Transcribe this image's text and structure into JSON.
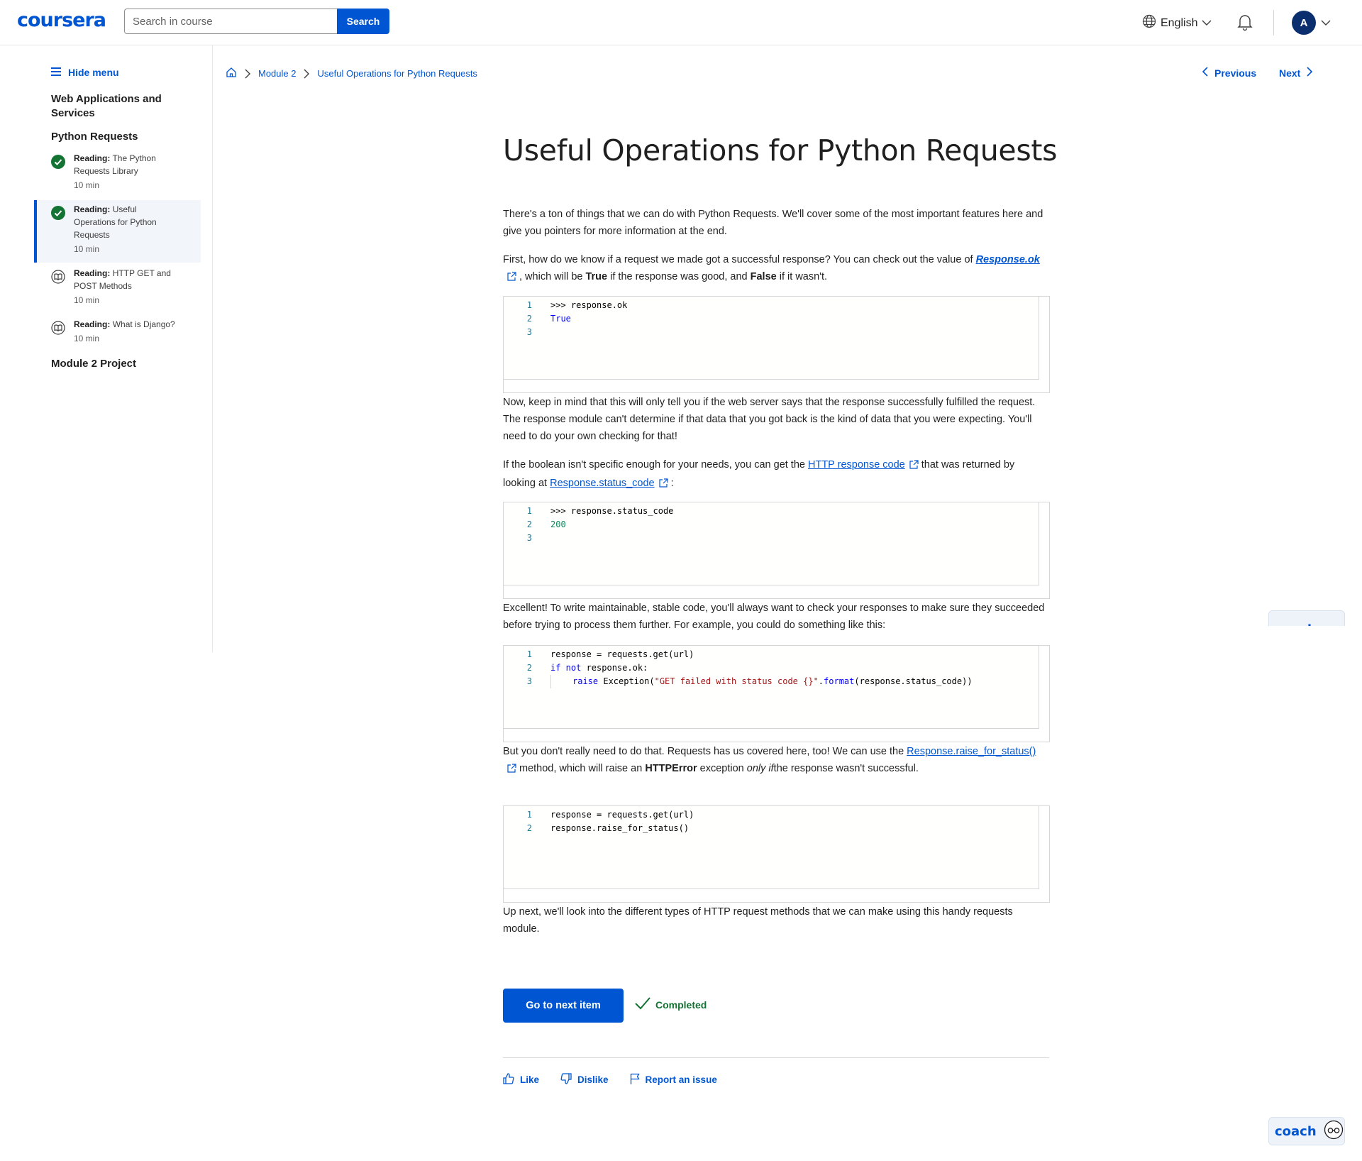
{
  "header": {
    "logo": "coursera",
    "search_placeholder": "Search in course",
    "search_button": "Search",
    "language": "English",
    "avatar_initial": "A"
  },
  "sidebar": {
    "hide_menu": "Hide menu",
    "course_title": "Web Applications and Services",
    "section_title": "Python Requests",
    "items": [
      {
        "type": "Reading:",
        "title": "The Python Requests Library",
        "duration": "10 min",
        "status": "completed"
      },
      {
        "type": "Reading:",
        "title": "Useful Operations for Python Requests",
        "duration": "10 min",
        "status": "completed"
      },
      {
        "type": "Reading:",
        "title": "HTTP GET and POST Methods",
        "duration": "10 min",
        "status": "not-started"
      },
      {
        "type": "Reading:",
        "title": "What is Django?",
        "duration": "10 min",
        "status": "not-started"
      }
    ],
    "module_project": "Module 2 Project"
  },
  "breadcrumb": {
    "items": [
      "Module 2",
      "Useful Operations for Python Requests"
    ]
  },
  "nav": {
    "previous": "Previous",
    "next": "Next"
  },
  "article": {
    "title": "Useful Operations for Python Requests",
    "p1": "There's a ton of things that we can do with Python Requests.  We'll cover some of the most important features here and give you pointers for more information at the end.",
    "p2_a": "First, how do we know if a request we made got a successful response? You can check out the value of",
    "p2_link": "Response.ok",
    "p2_b": ", which will be",
    "p2_true": "True",
    "p2_c": "if the response was good, and",
    "p2_false": "False",
    "p2_d": "if it wasn't.",
    "code1": [
      ">>> response.ok",
      "True",
      ""
    ],
    "p3": "Now, keep in mind that this will only tell you if the web server says that the response successfully fulfilled the request. The response module can't determine if that data that you got back is the kind of data that you were expecting. You'll need to do your own checking for that!",
    "p4_a": "If the boolean isn't specific enough for your needs, you can get the",
    "p4_link1": "HTTP response code",
    "p4_b": "that was returned by looking at",
    "p4_link2": "Response.status_code",
    "p4_c": ":",
    "code2": [
      ">>> response.status_code",
      "200",
      ""
    ],
    "p5": "Excellent! To write maintainable, stable code, you'll always want to check your responses to make sure they succeeded before trying to process them further. For example, you could do something like this:",
    "code3_l1": "response = requests.get(url)",
    "code3_l2_kw": "if not",
    "code3_l2_rest": " response.ok:",
    "code3_l3_kw": "raise",
    "code3_l3_a": " Exception(",
    "code3_l3_str": "\"GET failed with status code {}\"",
    "code3_l3_b": ".",
    "code3_l3_fn": "format",
    "code3_l3_c": "(response.status_code))",
    "p6_a": "But you don't really need to do that. Requests has us covered here, too! We can use the",
    "p6_link": "Response.raise_for_status()",
    "p6_b": "method, which will raise an",
    "p6_bold": "HTTPError",
    "p6_c": "exception",
    "p6_ital": "only if",
    "p6_d": "the response wasn't successful.",
    "code4": [
      "response = requests.get(url)",
      "response.raise_for_status()"
    ],
    "p7": "Up next, we'll look into the different types of HTTP request methods that we can make using this handy requests module."
  },
  "footer": {
    "next_button": "Go to next item",
    "completed": "Completed",
    "like": "Like",
    "dislike": "Dislike",
    "report": "Report an issue",
    "coach": "coach"
  },
  "colors": {
    "brand": "#0056d2",
    "success": "#137333"
  }
}
